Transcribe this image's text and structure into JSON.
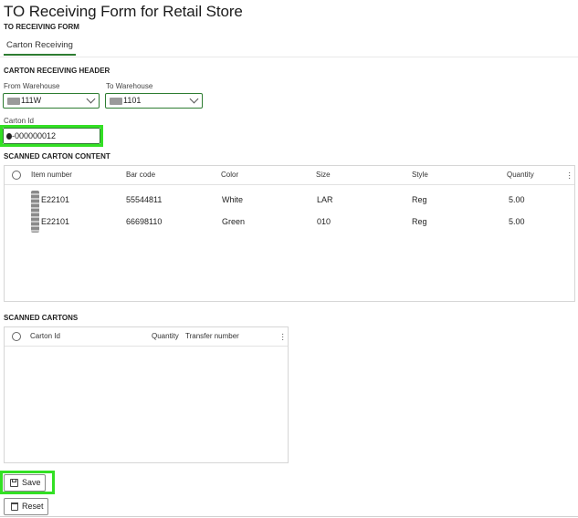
{
  "page": {
    "title": "TO Receiving Form for Retail Store",
    "subtitle": "TO RECEIVING FORM"
  },
  "tabs": [
    {
      "label": "Carton Receiving"
    }
  ],
  "header": {
    "section_title": "CARTON RECEIVING HEADER",
    "from_warehouse": {
      "label": "From Warehouse",
      "value": "111W"
    },
    "to_warehouse": {
      "label": "To Warehouse",
      "value": "1101"
    },
    "carton_id": {
      "label": "Carton Id",
      "value": "-000000012"
    }
  },
  "content": {
    "section_title": "SCANNED CARTON CONTENT",
    "columns": [
      "Item number",
      "Bar code",
      "Color",
      "Size",
      "Style",
      "Quantity"
    ],
    "rows": [
      {
        "item": "E22101",
        "barcode": "55544811",
        "color": "White",
        "size": "LAR",
        "style": "Reg",
        "qty": "5.00"
      },
      {
        "item": "E22101",
        "barcode": "66698110",
        "color": "Green",
        "size": "010",
        "style": "Reg",
        "qty": "5.00"
      }
    ]
  },
  "cartons": {
    "section_title": "SCANNED CARTONS",
    "columns": [
      "Carton Id",
      "Quantity",
      "Transfer number"
    ]
  },
  "actions": {
    "save_label": "Save",
    "reset_label": "Reset"
  },
  "icons": {
    "save": "save-icon",
    "reset": "trash-icon",
    "dropdown": "chevron-down-icon",
    "more": "more-options-icon"
  },
  "colors": {
    "accent": "#2e7d32",
    "highlight": "#33e024"
  }
}
